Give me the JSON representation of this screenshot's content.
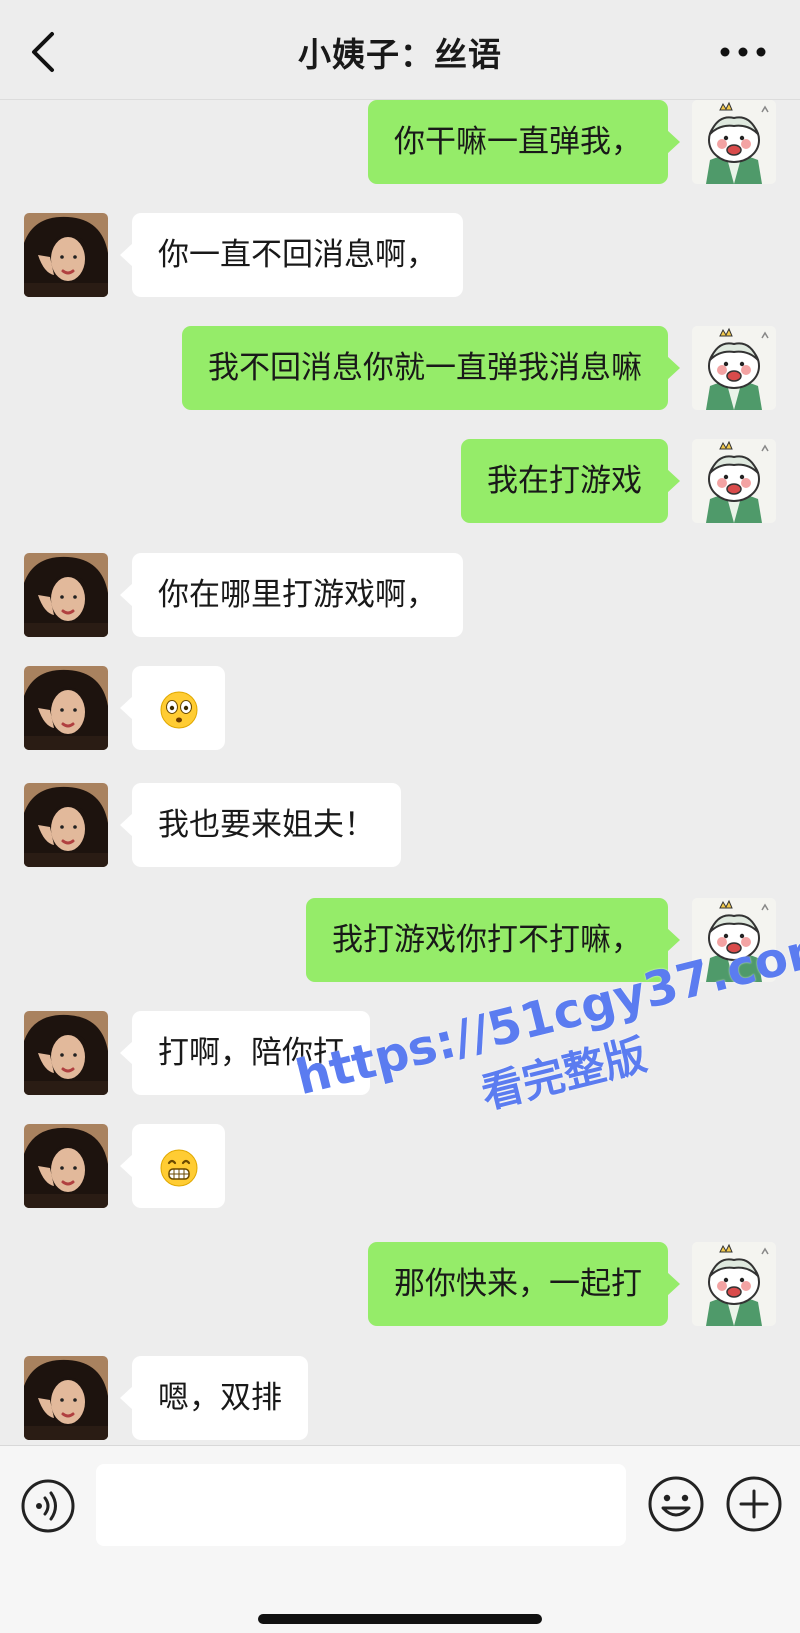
{
  "header": {
    "title": "小姨子：丝语",
    "back_icon": "chevron-left-icon",
    "more_icon": "more-horizontal-icon"
  },
  "messages": [
    {
      "side": "right",
      "type": "text",
      "text": "你干嘛一直弹我，"
    },
    {
      "side": "left",
      "type": "text",
      "text": "你一直不回消息啊，"
    },
    {
      "side": "right",
      "type": "text",
      "text": "我不回消息你就一直弹我消息嘛"
    },
    {
      "side": "right",
      "type": "text",
      "text": "我在打游戏"
    },
    {
      "side": "left",
      "type": "text",
      "text": "你在哪里打游戏啊，"
    },
    {
      "side": "left",
      "type": "emoji",
      "emoji": "flushed-face-icon"
    },
    {
      "side": "left",
      "type": "text",
      "text": "我也要来姐夫！"
    },
    {
      "side": "right",
      "type": "text",
      "text": "我打游戏你打不打嘛，"
    },
    {
      "side": "left",
      "type": "text",
      "text": "打啊，陪你打"
    },
    {
      "side": "left",
      "type": "emoji",
      "emoji": "grinning-face-icon"
    },
    {
      "side": "right",
      "type": "text",
      "text": "那你快来，一起打"
    },
    {
      "side": "left",
      "type": "text",
      "text": "嗯，双排"
    }
  ],
  "watermark": {
    "url": "https://51cgy37.com",
    "label": "看完整版"
  },
  "input_bar": {
    "value": "",
    "voice_icon": "voice-icon",
    "emoji_icon": "smiley-icon",
    "plus_icon": "plus-circle-icon"
  },
  "colors": {
    "background": "#ededed",
    "sent_bubble": "#95ec69",
    "received_bubble": "#ffffff",
    "watermark": "#5b7cf0"
  }
}
